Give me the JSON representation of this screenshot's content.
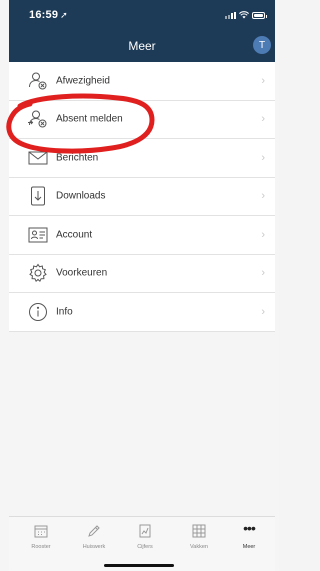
{
  "status": {
    "time": "16:59",
    "location_glyph": "➚"
  },
  "header": {
    "title": "Meer",
    "avatar_initial": "T"
  },
  "menu": [
    {
      "label": "Afwezigheid",
      "icon": "person-x-icon"
    },
    {
      "label": "Absent melden",
      "icon": "person-report-icon"
    },
    {
      "label": "Berichten",
      "icon": "envelope-icon"
    },
    {
      "label": "Downloads",
      "icon": "download-icon"
    },
    {
      "label": "Account",
      "icon": "id-card-icon"
    },
    {
      "label": "Voorkeuren",
      "icon": "gear-icon"
    },
    {
      "label": "Info",
      "icon": "info-icon"
    }
  ],
  "chevron": "›",
  "tabbar": [
    {
      "label": "Rooster",
      "icon": "calendar-icon"
    },
    {
      "label": "Huiswerk",
      "icon": "pencil-icon"
    },
    {
      "label": "Cijfers",
      "icon": "chart-icon"
    },
    {
      "label": "Vakken",
      "icon": "grid-icon"
    },
    {
      "label": "Meer",
      "icon": "more-icon",
      "glyph": "•••",
      "active": true
    }
  ],
  "colors": {
    "header": "#1d3a56",
    "annotation": "#e0201f",
    "avatar": "#4d7bb4"
  }
}
